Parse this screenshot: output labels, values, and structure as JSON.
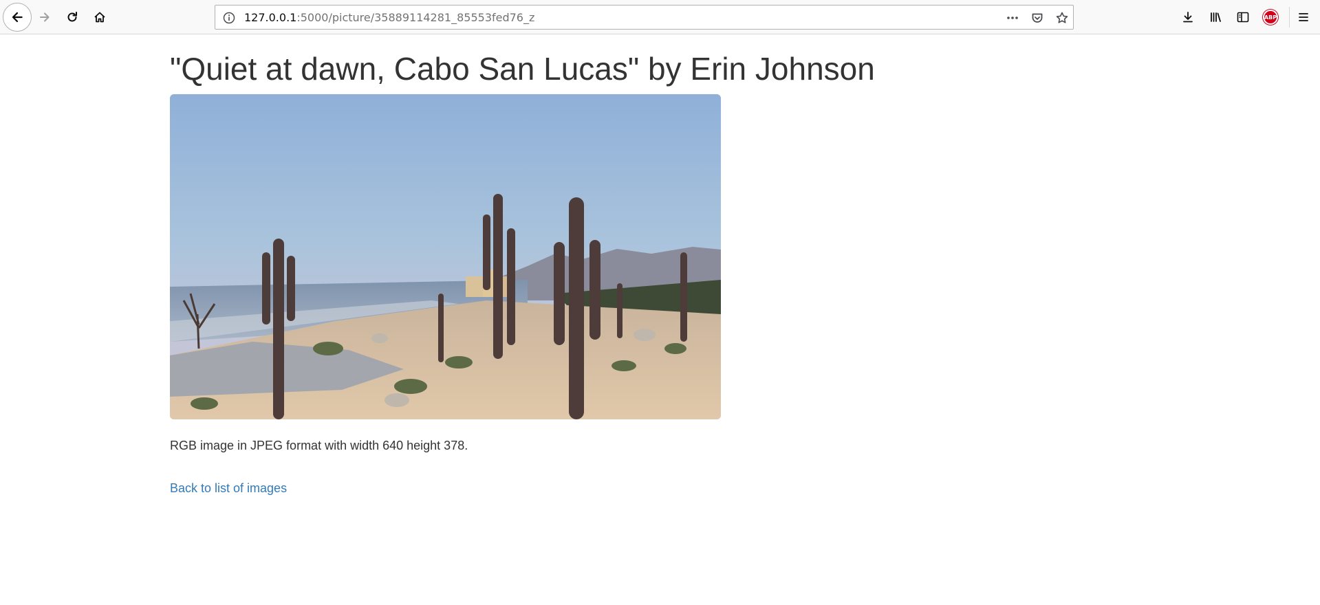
{
  "browser": {
    "url_host": "127.0.0.1",
    "url_rest": ":5000/picture/35889114281_85553fed76_z",
    "icons": {
      "back": "back-arrow-icon",
      "forward": "forward-arrow-icon",
      "reload": "reload-icon",
      "home": "home-icon",
      "info": "info-icon",
      "page_actions": "more-dots-icon",
      "pocket": "pocket-icon",
      "bookmark": "star-icon",
      "downloads": "download-icon",
      "library": "library-icon",
      "sidebar": "sidebar-icon",
      "adblock": "adblock-plus-icon",
      "menu": "hamburger-menu-icon"
    },
    "adblock_label": "ABP"
  },
  "page": {
    "title": "\"Quiet at dawn, Cabo San Lucas\" by Erin Johnson",
    "caption": "RGB image in JPEG format with width 640 height 378.",
    "back_link": "Back to list of images"
  },
  "colors": {
    "link": "#337ab7",
    "text": "#333333",
    "toolbar_bg": "#f9f9fa",
    "adblock_red": "#d0011b"
  }
}
